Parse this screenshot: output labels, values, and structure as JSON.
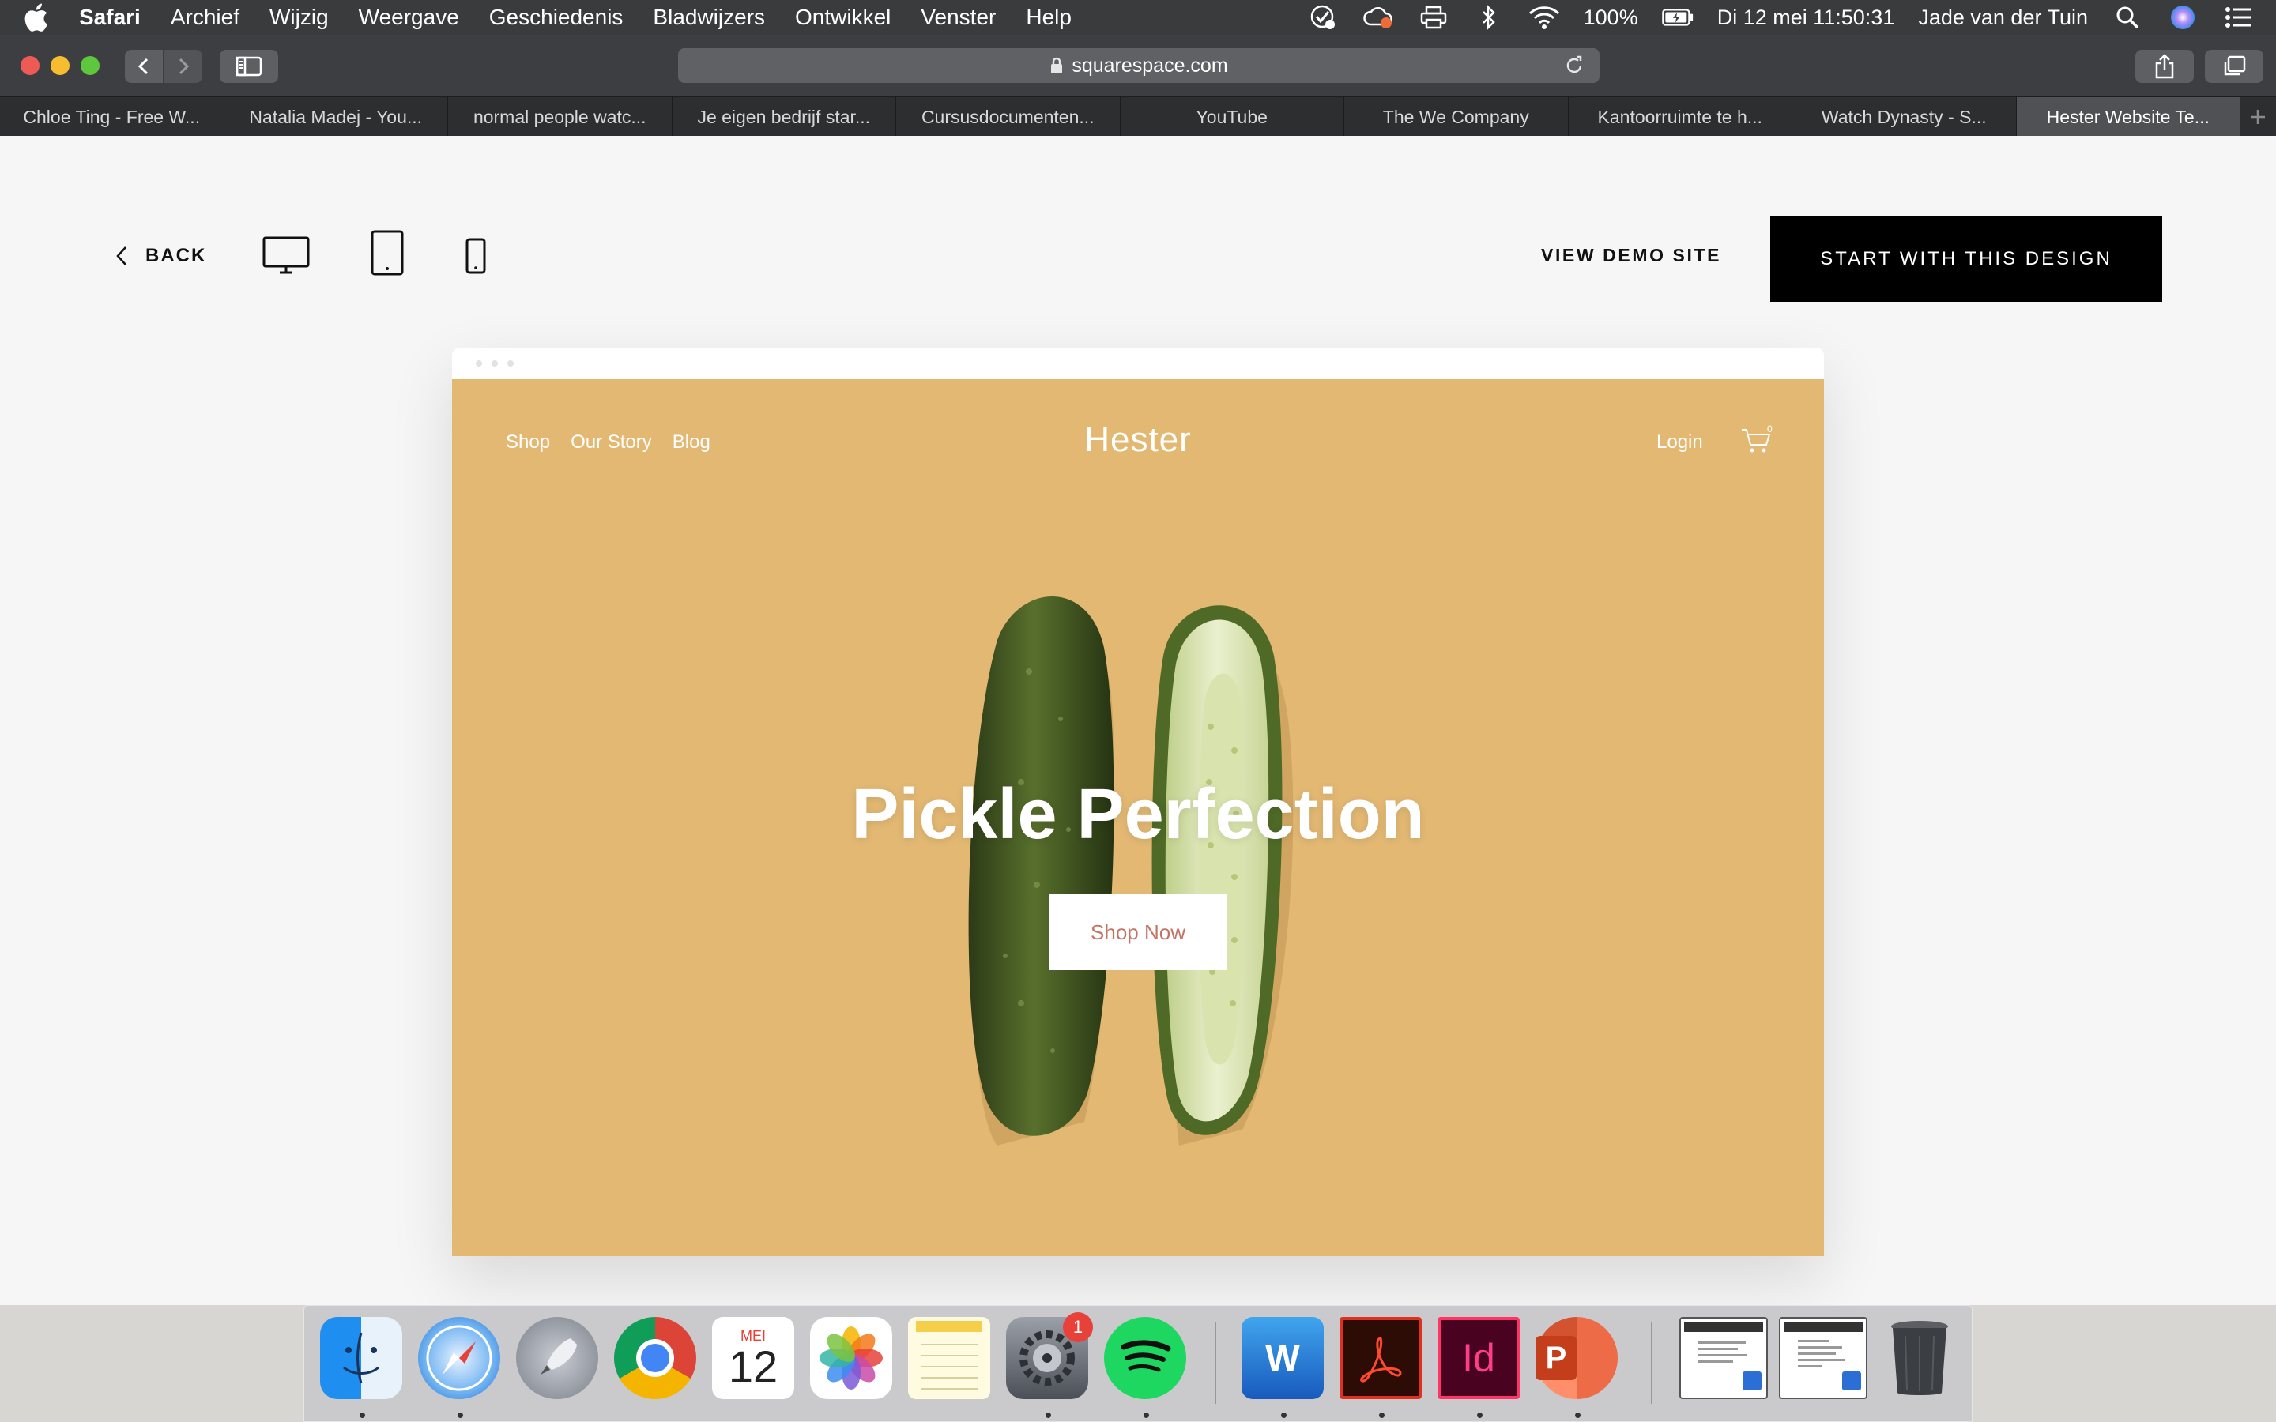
{
  "menubar": {
    "app_name": "Safari",
    "items": [
      "Archief",
      "Wijzig",
      "Weergave",
      "Geschiedenis",
      "Bladwijzers",
      "Ontwikkel",
      "Venster",
      "Help"
    ],
    "battery": "100%",
    "datetime": "Di 12 mei  11:50:31",
    "user": "Jade van der Tuin"
  },
  "browser": {
    "url": "squarespace.com",
    "tabs": [
      "Chloe Ting - Free W...",
      "Natalia Madej - You...",
      "normal people watc...",
      "Je eigen bedrijf star...",
      "Cursusdocumenten...",
      "YouTube",
      "The We Company",
      "Kantoorruimte te h...",
      "Watch Dynasty - S...",
      "Hester Website Te..."
    ],
    "active_tab": 9
  },
  "page": {
    "back_label": "BACK",
    "view_demo_label": "VIEW DEMO SITE",
    "start_label": "START WITH THIS DESIGN"
  },
  "site": {
    "nav": [
      "Shop",
      "Our Story",
      "Blog"
    ],
    "brand": "Hester",
    "login": "Login",
    "cart_count": "0",
    "hero_title": "Pickle Perfection",
    "cta": "Shop Now",
    "background_color": "#e2b873"
  },
  "dock": {
    "apps": [
      "finder",
      "safari",
      "launchpad",
      "chrome",
      "calendar",
      "photos",
      "notes",
      "system-preferences",
      "spotify",
      "word",
      "acrobat",
      "indesign",
      "powerpoint",
      "word-document-1",
      "word-document-2",
      "trash"
    ],
    "calendar_month": "MEI",
    "calendar_day": "12",
    "system_preferences_badge": "1",
    "indesign_label": "Id",
    "word_label": "W",
    "powerpoint_label": "P"
  }
}
